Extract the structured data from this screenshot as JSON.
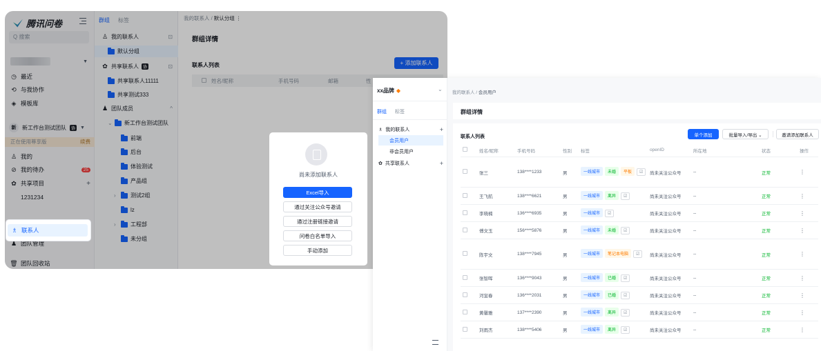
{
  "left": {
    "logo": "腾讯问卷",
    "search_placeholder": "Q 搜索",
    "nav": [
      "最近",
      "与我协作",
      "模板库"
    ],
    "team_avatar": "新",
    "team_name": "新工作台测试团队",
    "team_tag": "协",
    "using_text": "正在使用尊享版",
    "using_link": "续费",
    "menu": [
      {
        "label": "我的",
        "icon": "user-icon"
      },
      {
        "label": "我的待办",
        "icon": "check-icon",
        "badge": "25"
      },
      {
        "label": "共享项目",
        "icon": "share-icon",
        "plus": "+"
      },
      {
        "label": "1231234",
        "icon": ""
      }
    ],
    "contacts": "联系人",
    "team_mgmt": "团队管理",
    "recycle": "团队回收站",
    "tabs": [
      "群组",
      "标签"
    ],
    "tree": [
      {
        "label": "我的联系人",
        "type": "person",
        "right": "⊡",
        "indent": 0
      },
      {
        "label": "默认分组",
        "type": "folder",
        "indent": 1,
        "selected": true
      },
      {
        "label": "共享联系人",
        "type": "share",
        "tag": "协",
        "right": "⊡",
        "indent": 0
      },
      {
        "label": "共享联系人11111",
        "type": "folder",
        "indent": 1
      },
      {
        "label": "共享测试333",
        "type": "folder",
        "indent": 1
      },
      {
        "label": "团队成员",
        "type": "team",
        "right": "^",
        "indent": 0
      },
      {
        "label": "新工作台测试团队",
        "type": "folder",
        "indent": 1,
        "arrow": "⌄"
      },
      {
        "label": "前端",
        "type": "folder",
        "indent": 2
      },
      {
        "label": "后台",
        "type": "folder",
        "indent": 2
      },
      {
        "label": "体验测试",
        "type": "folder",
        "indent": 2
      },
      {
        "label": "产品组",
        "type": "folder",
        "indent": 2
      },
      {
        "label": "测试2组",
        "type": "folder",
        "indent": 2,
        "arrow": "›"
      },
      {
        "label": "lz",
        "type": "folder",
        "indent": 2
      },
      {
        "label": "工程部",
        "type": "folder",
        "indent": 2,
        "arrow": "›"
      },
      {
        "label": "未分组",
        "type": "folder",
        "indent": 2
      }
    ],
    "breadcrumb_root": "我的联系人 / ",
    "breadcrumb_current": "默认分组 ⋮",
    "group_detail": "群组详情",
    "contact_list": "联系人列表",
    "add_contact": "+ 添加联系人",
    "columns": [
      "姓名/昵称",
      "手机号码",
      "邮箱",
      "性"
    ],
    "modal": {
      "empty": "尚未添加联系人",
      "buttons": [
        "Excel导入",
        "通过关注公众号邀请",
        "通过注册链接邀请",
        "问卷白名单导入",
        "手动添加"
      ]
    }
  },
  "right": {
    "brand": "xx品牌",
    "brand_gem": "◆",
    "tabs": [
      "群组",
      "标签"
    ],
    "tree": [
      {
        "label": "我的联系人",
        "plus": "+",
        "icon": "contacts-icon"
      },
      {
        "label": "会员用户",
        "selected": true
      },
      {
        "label": "非会员用户"
      },
      {
        "label": "共享联系人",
        "plus": "+",
        "icon": "share-icon"
      }
    ],
    "breadcrumb_root": "我的联系人 / ",
    "breadcrumb_current": "会员用户",
    "group_detail": "群组详情",
    "contact_list": "联系人列表",
    "btn_add": "单个添加",
    "btn_io": "批量导入/导出 ⌄",
    "btn_invite": "邀请添加联系人",
    "columns": [
      "",
      "姓名/昵称",
      "手机号码",
      "性别",
      "标签",
      "openID",
      "所在地",
      "状态",
      "操作"
    ],
    "rows": [
      {
        "name": "张三",
        "phone": "138****1233",
        "sex": "男",
        "tags": [
          [
            "一线城市",
            "blue"
          ],
          [
            "未婚",
            "green"
          ],
          [
            "平板",
            "orange"
          ]
        ],
        "openid": "尚未关注公众号",
        "loc": "--",
        "status": "正常"
      },
      {
        "name": "王飞航",
        "phone": "138****6621",
        "sex": "男",
        "tags": [
          [
            "一线城市",
            "blue"
          ],
          [
            "离异",
            "green"
          ]
        ],
        "openid": "尚未关注公众号",
        "loc": "--",
        "status": "正常"
      },
      {
        "name": "李晓楠",
        "phone": "136****6935",
        "sex": "男",
        "tags": [
          [
            "一线城市",
            "blue"
          ]
        ],
        "openid": "尚未关注公众号",
        "loc": "--",
        "status": "正常"
      },
      {
        "name": "傅文玉",
        "phone": "156****5876",
        "sex": "男",
        "tags": [
          [
            "一线城市",
            "blue"
          ],
          [
            "未婚",
            "green"
          ]
        ],
        "openid": "尚未关注公众号",
        "loc": "--",
        "status": "正常"
      },
      {
        "name": "陈宇文",
        "phone": "138****7945",
        "sex": "男",
        "tags": [
          [
            "一线城市",
            "blue"
          ],
          [
            "笔记本电脑",
            "orange"
          ]
        ],
        "openid": "尚未关注公众号",
        "loc": "--",
        "status": "正常"
      },
      {
        "name": "张智晖",
        "phone": "136****9043",
        "sex": "男",
        "tags": [
          [
            "一线城市",
            "blue"
          ],
          [
            "已婚",
            "green"
          ]
        ],
        "openid": "尚未关注公众号",
        "loc": "--",
        "status": "正常"
      },
      {
        "name": "河宣春",
        "phone": "136****2031",
        "sex": "男",
        "tags": [
          [
            "一线城市",
            "blue"
          ],
          [
            "已婚",
            "green"
          ]
        ],
        "openid": "尚未关注公众号",
        "loc": "--",
        "status": "正常"
      },
      {
        "name": "黄馨雅",
        "phone": "137****2390",
        "sex": "男",
        "tags": [
          [
            "一线城市",
            "blue"
          ],
          [
            "离异",
            "green"
          ]
        ],
        "openid": "尚未关注公众号",
        "loc": "--",
        "status": "正常"
      },
      {
        "name": "刘雨杰",
        "phone": "138****5406",
        "sex": "男",
        "tags": [
          [
            "一线城市",
            "blue"
          ],
          [
            "离异",
            "green"
          ]
        ],
        "openid": "尚未关注公众号",
        "loc": "--",
        "status": "正常"
      }
    ],
    "edit_icon": "☑",
    "more": "⋮"
  },
  "colors": {
    "primary": "#1664ff",
    "success": "#00b42a",
    "warning": "#ff7d00",
    "danger": "#f53f3f"
  }
}
